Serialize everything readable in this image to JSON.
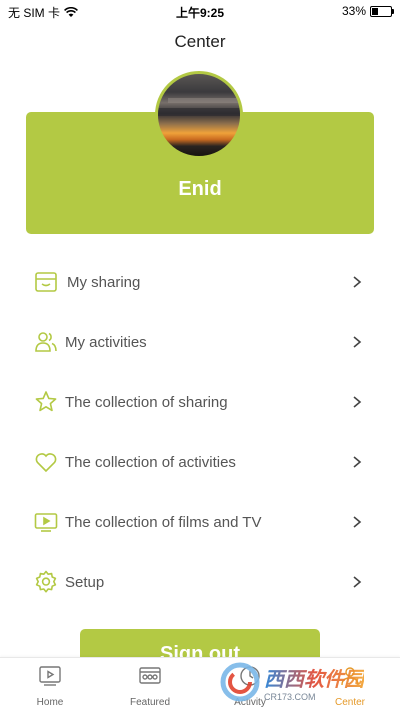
{
  "status_bar": {
    "carrier": "无 SIM 卡",
    "time": "上午9:25",
    "battery_percent": "33%",
    "battery_level": 0.33
  },
  "nav": {
    "title": "Center"
  },
  "profile": {
    "name": "Enid"
  },
  "menu": {
    "items": [
      {
        "label": "My sharing",
        "icon": "store-icon"
      },
      {
        "label": "My activities",
        "icon": "people-icon"
      },
      {
        "label": "The collection of sharing",
        "icon": "star-icon"
      },
      {
        "label": "The collection of activities",
        "icon": "heart-icon"
      },
      {
        "label": "The collection of films and TV",
        "icon": "tv-play-icon"
      },
      {
        "label": "Setup",
        "icon": "gear-icon"
      }
    ]
  },
  "signout": {
    "label": "Sign out"
  },
  "tabbar": {
    "tabs": [
      {
        "label": "Home",
        "icon": "play-screen-icon"
      },
      {
        "label": "Featured",
        "icon": "film-icon"
      },
      {
        "label": "Activity",
        "icon": "activity-icon"
      },
      {
        "label": "Center",
        "icon": "person-icon",
        "active": true
      }
    ]
  },
  "watermark": {
    "brand": "西西软件园",
    "url": "CR173.COM"
  },
  "colors": {
    "accent": "#b3c944",
    "active_tab": "#e59a2a"
  }
}
